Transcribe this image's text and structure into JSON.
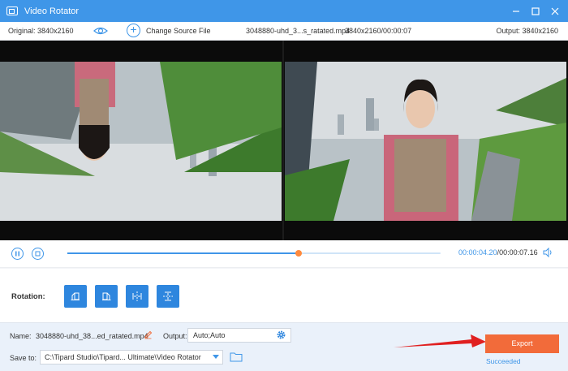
{
  "window": {
    "title": "Video Rotator"
  },
  "info_bar": {
    "original": "Original: 3840x2160",
    "change_source": "Change Source File",
    "file_name": "3048880-uhd_3...s_ratated.mp4",
    "file_info": "3840x2160/00:00:07",
    "output": "Output: 3840x2160"
  },
  "player": {
    "current_time": "00:00:04.20",
    "separator": "/",
    "total_time": "00:00:07.16",
    "progress": 0.62
  },
  "rotation": {
    "label": "Rotation:",
    "buttons": [
      {
        "name": "rotate-left-button",
        "icon": "rotate-left-icon"
      },
      {
        "name": "rotate-right-button",
        "icon": "rotate-right-icon"
      },
      {
        "name": "flip-horizontal-button",
        "icon": "flip-horizontal-icon"
      },
      {
        "name": "flip-vertical-button",
        "icon": "flip-vertical-icon"
      }
    ]
  },
  "bottom": {
    "name_label": "Name:",
    "name_value": "3048880-uhd_38...ed_ratated.mp4",
    "output_label": "Output:",
    "output_value": "Auto;Auto",
    "save_label": "Save to:",
    "save_path": "C:\\Tipard Studio\\Tipard... Ultimate\\Video Rotator",
    "export_label": "Export",
    "status": "Succeeded"
  },
  "colors": {
    "accent": "#3f96e8",
    "export": "#f26b3a",
    "knob": "#ff8a3d",
    "arrow": "#e02020"
  }
}
